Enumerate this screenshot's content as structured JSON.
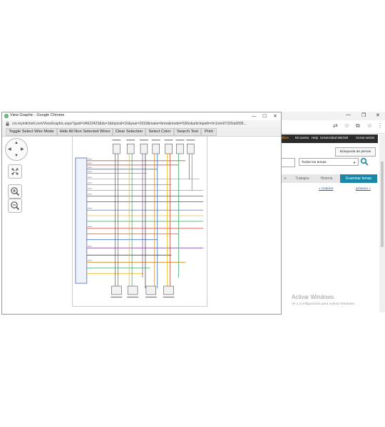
{
  "popup": {
    "title": "View Graphic - Google Chrome",
    "url": "crs.mymitchell.com/ViewGraphic.aspx?guid=VA623423&ds=1&topicid=16&year=2018&make=bmw&model=530e&articlepath=/m1/xml/7/2/0/a0095...",
    "toolbar": {
      "toggle_select": "Toggle Select Wire Mode",
      "hide_all": "Hide All Non Selected Wires",
      "clear_selection": "Clear Selection",
      "select_color": "Select Color",
      "search_text": "Search Text",
      "print": "Print"
    }
  },
  "background": {
    "nav": {
      "item0": "álisis",
      "item1": "Mi cuenta",
      "item2": "Help",
      "item3": "Universidad Mitchell",
      "item4": "Cerrar sesión"
    },
    "parts_search": "Búsqueda de piezas",
    "topic_select": "Todos los temas",
    "tabs": [
      "o",
      "Trabajos",
      "Historia",
      "Examinar temas"
    ],
    "prev_link": "« Anterior",
    "next_link": "próximo »",
    "activate_title": "Activar Windows",
    "activate_sub": "Ve a Configuración para activar Windows."
  },
  "colors": {
    "accent_tab": "#1a87a8",
    "nav_bar": "#2b2b2b",
    "link": "#1a5fa8"
  }
}
